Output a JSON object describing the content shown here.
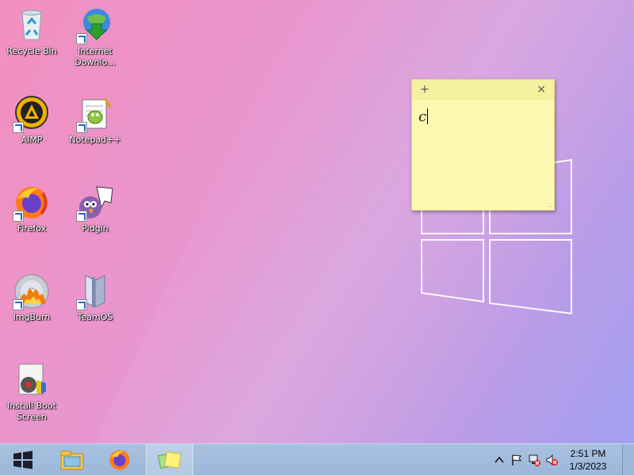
{
  "desktop": {
    "icons": [
      {
        "label": "Recycle Bin"
      },
      {
        "label": "Internet Downlo..."
      },
      {
        "label": "AIMP"
      },
      {
        "label": "Notepad++"
      },
      {
        "label": "Firefox"
      },
      {
        "label": "Pidgin"
      },
      {
        "label": "ImgBurn"
      },
      {
        "label": "TeamOS"
      },
      {
        "label": "Install Boot Screen"
      }
    ]
  },
  "sticky_note": {
    "add_symbol": "+",
    "close_symbol": "×",
    "text": "c",
    "grip_symbol": ".:"
  },
  "taskbar": {
    "start_icon": "windows-start-icon",
    "pinned": [
      "explorer-icon",
      "firefox-icon",
      "sticky-notes-icon"
    ],
    "tray_icons": [
      "chevron-up-icon",
      "action-center-flag-icon",
      "network-icon",
      "volume-muted-icon"
    ],
    "time": "2:51 PM",
    "date": "1/3/2023"
  },
  "colors": {
    "sticky_background": "#fdf8b2",
    "taskbar_background": "#a9c1e0"
  }
}
